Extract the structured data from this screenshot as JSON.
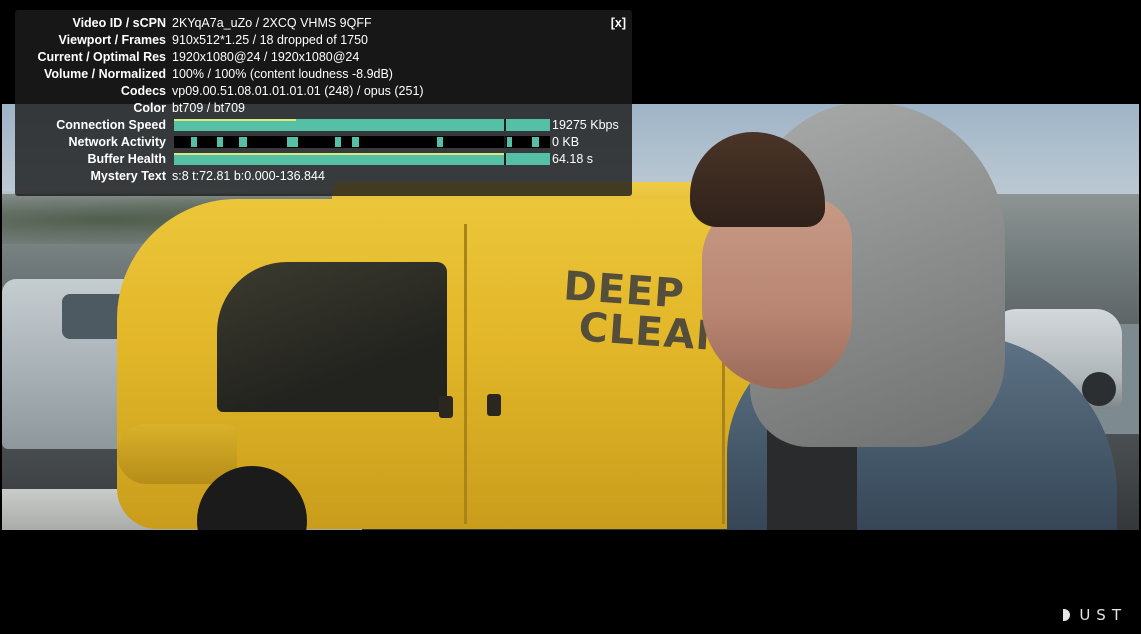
{
  "stats": {
    "close_label": "[x]",
    "rows": [
      {
        "label": "Video ID / sCPN",
        "value": "2KYqA7a_uZo / 2XCQ VHMS 9QFF"
      },
      {
        "label": "Viewport / Frames",
        "value": "910x512*1.25 / 18 dropped of 1750"
      },
      {
        "label": "Current / Optimal Res",
        "value": "1920x1080@24 / 1920x1080@24"
      },
      {
        "label": "Volume / Normalized",
        "value": "100% / 100% (content loudness -8.9dB)"
      },
      {
        "label": "Codecs",
        "value": "vp09.00.51.08.01.01.01.01 (248) / opus (251)"
      },
      {
        "label": "Color",
        "value": "bt709 / bt709"
      }
    ],
    "connection_speed": {
      "label": "Connection Speed",
      "value": "19275 Kbps",
      "fill": 1.0
    },
    "network_activity": {
      "label": "Network Activity",
      "value": "0 KB"
    },
    "buffer_health": {
      "label": "Buffer Health",
      "value": "64.18 s",
      "fill": 1.0
    },
    "mystery_text": {
      "label": "Mystery Text",
      "value": "s:8 t:72.81 b:0.000-136.844"
    },
    "bar_color": "#55c0a6",
    "bar_edge_color": "#d8e87c"
  },
  "video": {
    "van_lettering_line1": "DEEP",
    "van_lettering_line2": "CLEAN"
  },
  "watermark": {
    "text": "UST"
  }
}
